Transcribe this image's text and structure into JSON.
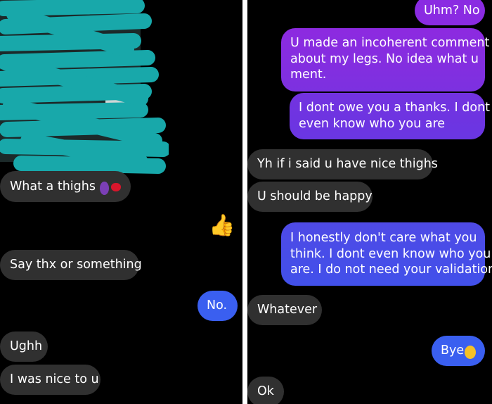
{
  "left": {
    "messages": [
      {
        "text": "What a thighs",
        "emoji": [
          "devil-face-icon",
          "kiss-mark-icon"
        ]
      },
      {
        "reaction": "👍"
      },
      {
        "text": "Say thx or something"
      },
      {
        "text": "No."
      },
      {
        "text": "Ughh"
      },
      {
        "text": "I was nice to u"
      }
    ]
  },
  "right": {
    "messages": [
      {
        "text": "Uhm? No"
      },
      {
        "lines": [
          "U made an incoherent comment",
          "about my legs. No idea what u",
          "ment."
        ]
      },
      {
        "lines": [
          "I dont owe you a thanks. I dont",
          "even know who you are"
        ]
      },
      {
        "text": "Yh if i said u have nice thighs"
      },
      {
        "text": "U should be happy"
      },
      {
        "lines": [
          "I honestly don't care what you",
          "think. I dont even know who you",
          "are. I do not need your validation"
        ]
      },
      {
        "text": "Whatever"
      },
      {
        "text": "Bye",
        "emoji": [
          "laughing-face-icon"
        ]
      },
      {
        "text": "Ok"
      }
    ]
  },
  "colors": {
    "background": "#000000",
    "received_bubble": "#303030",
    "sent_purple": "#8a2be2",
    "sent_blue": "#3a5ff0",
    "redaction": "#18a8aa"
  }
}
